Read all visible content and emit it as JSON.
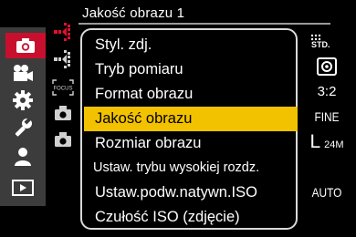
{
  "header": {
    "title": "Jakość obrazu 1"
  },
  "categories": [
    {
      "name": "camera-icon",
      "active": true
    },
    {
      "name": "video-camera-icon",
      "active": false
    },
    {
      "name": "gear-icon",
      "active": false
    },
    {
      "name": "wrench-icon",
      "active": false
    },
    {
      "name": "person-icon",
      "active": false
    },
    {
      "name": "playback-icon",
      "active": false
    }
  ],
  "menu": {
    "items": [
      {
        "label": "Styl. zdj.",
        "value": "STD."
      },
      {
        "label": "Tryb pomiaru",
        "value": ""
      },
      {
        "label": "Format obrazu",
        "value": "3:2"
      },
      {
        "label": "Jakość obrazu",
        "value": "FINE",
        "selected": true
      },
      {
        "label": "Rozmiar obrazu",
        "value_big": "L",
        "value_small": "24M"
      },
      {
        "label": "Ustaw. trybu wysokiej rozdz.",
        "value": ""
      },
      {
        "label": "Ustaw.podw.natywn.ISO",
        "value": "AUTO"
      },
      {
        "label": "Czułość ISO (zdjęcie)",
        "value": ""
      }
    ]
  },
  "tab_icons": {
    "focus_label": "FOCUS"
  },
  "colors": {
    "accent_red": "#c8102e",
    "selection_yellow": "#f2c200"
  }
}
